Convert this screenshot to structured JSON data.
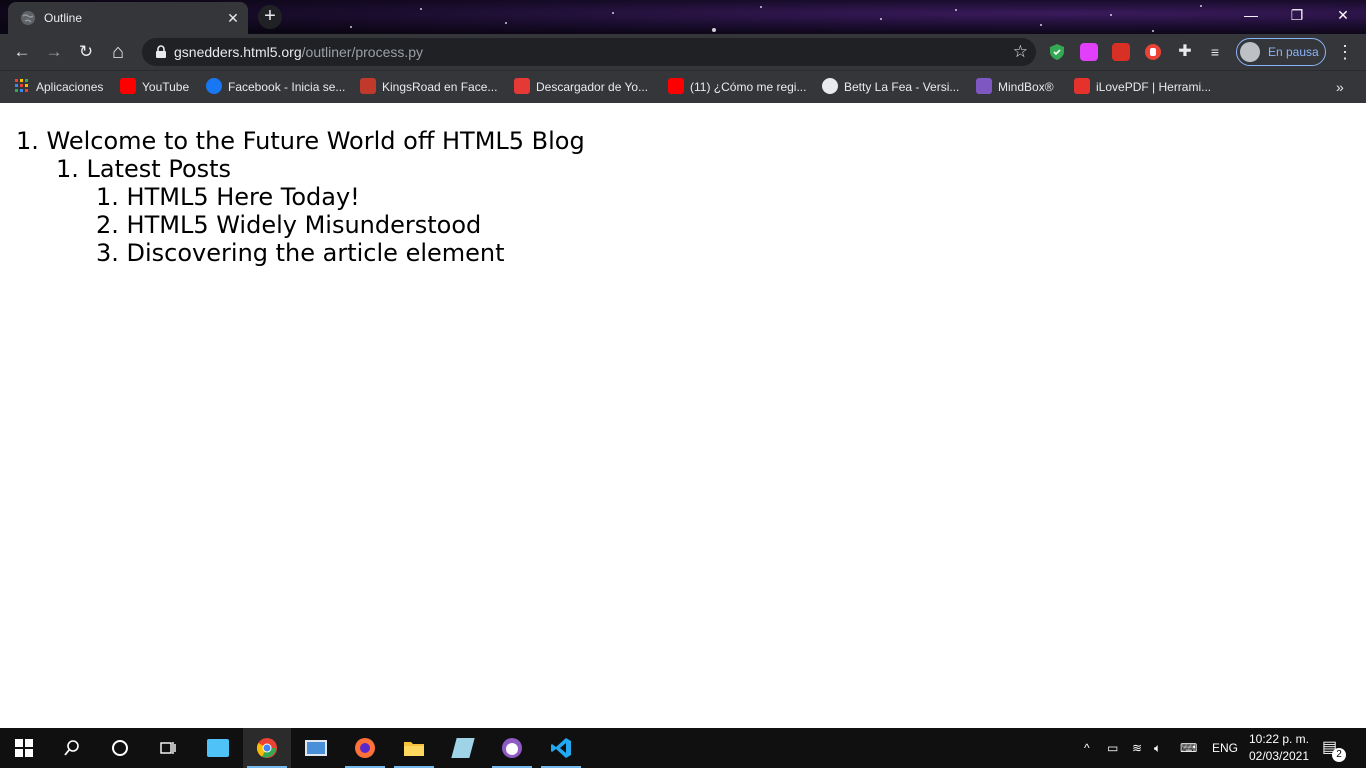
{
  "browser": {
    "tab": {
      "title": "Outline",
      "close_glyph": "✕",
      "favicon": "globe-icon"
    },
    "new_tab_glyph": "+",
    "window_controls": {
      "minimize": "—",
      "restore": "❐",
      "close": "✕"
    },
    "nav": {
      "back": "←",
      "forward": "→",
      "reload": "↻",
      "home": "⌂"
    },
    "address": {
      "host": "gsnedders.html5.org",
      "path": "/outliner/process.py"
    },
    "bookmark_star": "☆",
    "profile": {
      "label": "En pausa"
    },
    "menu_glyph": "⋮",
    "bookmarks": [
      {
        "label": "Aplicaciones",
        "icon": "apps-grid-icon",
        "color": "#e8eaed"
      },
      {
        "label": "YouTube",
        "icon": "youtube-icon",
        "color": "#ff0000"
      },
      {
        "label": "Facebook - Inicia se...",
        "icon": "facebook-icon",
        "color": "#1877f2"
      },
      {
        "label": "KingsRoad en Face...",
        "icon": "kingsroad-icon",
        "color": "#c0392b"
      },
      {
        "label": "Descargador de Yo...",
        "icon": "download-icon",
        "color": "#e53935"
      },
      {
        "label": "(11) ¿Cómo me regi...",
        "icon": "youtube-icon",
        "color": "#ff0000"
      },
      {
        "label": "Betty La Fea - Versi...",
        "icon": "globe-icon",
        "color": "#e8eaed"
      },
      {
        "label": "MindBox®",
        "icon": "mindbox-icon",
        "color": "#7e57c2"
      },
      {
        "label": "iLovePDF | Herrami...",
        "icon": "ilovepdf-icon",
        "color": "#e5322d"
      }
    ],
    "bookmarks_more": "»"
  },
  "outline": {
    "level1": "1. Welcome to the Future World off HTML5 Blog",
    "level2": "1. Latest Posts",
    "items": [
      "1. HTML5 Here Today!",
      "2. HTML5 Widely Misunderstood",
      "3. Discovering the article element"
    ]
  },
  "taskbar": {
    "start": "start-icon",
    "search": "search-icon",
    "cortana": "cortana-icon",
    "task_view": "task-view-icon",
    "tray": {
      "language": "ENG"
    },
    "clock": {
      "time": "10:22 p. m.",
      "date": "02/03/2021"
    },
    "notifications_count": "2"
  }
}
